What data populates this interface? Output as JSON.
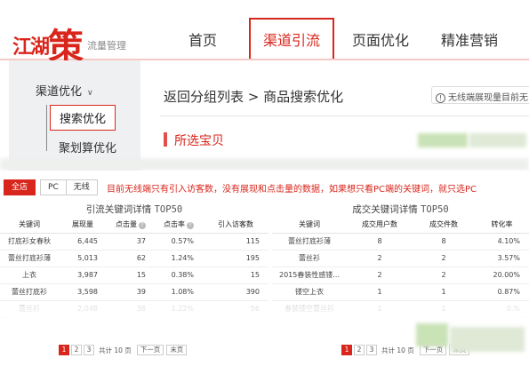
{
  "logo": {
    "brand_small": "江湖",
    "brand_big": "策",
    "tagline": "流量管理"
  },
  "nav": {
    "items": [
      "首页",
      "渠道引流",
      "页面优化",
      "精准营销"
    ],
    "active": "渠道引流"
  },
  "sidebar": {
    "group_label": "渠道优化",
    "items": [
      "搜索优化",
      "聚划算优化"
    ]
  },
  "breadcrumb": "返回分组列表 > 商品搜索优化",
  "hint": "无线端展现量目前无",
  "section_title": "所选宝贝",
  "toggle": {
    "all": "全店",
    "pc": "PC",
    "wireless": "无线"
  },
  "notice": "目前无线端只有引入访客数，没有展现和点击量的数据，如果想只看PC端的关键词，就只选PC",
  "left_table": {
    "title": "引流关键词详情",
    "title_badge": "TOP50",
    "headers": [
      "关键词",
      "展现量",
      "点击量",
      "点击率",
      "引入访客数"
    ],
    "rows": [
      [
        "打底衫女春秋",
        "6,445",
        "37",
        "0.57%",
        "115"
      ],
      [
        "蕾丝打底衫薄",
        "5,013",
        "62",
        "1.24%",
        "195"
      ],
      [
        "上衣",
        "3,987",
        "15",
        "0.38%",
        "15"
      ],
      [
        "蕾丝打底衫",
        "3,598",
        "39",
        "1.08%",
        "390"
      ],
      [
        "蕾丝衫",
        "2,048",
        "36",
        "1.22%",
        "56"
      ]
    ],
    "pager": {
      "pages": [
        "1",
        "2",
        "3"
      ],
      "current": "1",
      "total_text": "共计 10 页",
      "next": "下一页",
      "last": "末页"
    }
  },
  "right_table": {
    "title": "成交关键词详情",
    "title_badge": "TOP50",
    "headers": [
      "关键词",
      "成交用户数",
      "成交件数",
      "转化率"
    ],
    "rows": [
      [
        "蕾丝打底衫薄",
        "8",
        "8",
        "4.10%"
      ],
      [
        "蕾丝衫",
        "2",
        "2",
        "3.57%"
      ],
      [
        "2015春装性感镂...",
        "2",
        "2",
        "20.00%"
      ],
      [
        "镂空上衣",
        "1",
        "1",
        "0.87%"
      ],
      [
        "春装镂空蕾丝衫",
        "1",
        "1",
        "0.%"
      ]
    ],
    "pager": {
      "pages": [
        "1",
        "2",
        "3"
      ],
      "current": "1",
      "total_text": "共计 10 页",
      "next": "下一页",
      "last": "末页"
    }
  },
  "colors": {
    "accent": "#d9261c",
    "sidebar_bg": "#eef0f2",
    "blur_green": "#c9e2b6"
  }
}
